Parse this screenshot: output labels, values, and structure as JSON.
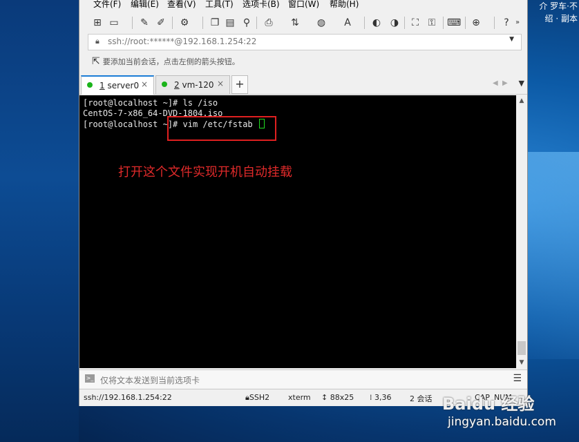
{
  "menu": [
    "文件(F)",
    "编辑(E)",
    "查看(V)",
    "工具(T)",
    "选项卡(B)",
    "窗口(W)",
    "帮助(H)"
  ],
  "desktop_right_text": [
    "介  罗车·不",
    "绍 · 副本"
  ],
  "address": {
    "lock_icon": "lock-icon",
    "text": "ssh://root:******@192.168.1.254:22"
  },
  "hint": "要添加当前会话，点击左侧的箭头按钮。",
  "tabs": [
    {
      "num": "1",
      "label": "server0",
      "active": true
    },
    {
      "num": "2",
      "label": "vm-120",
      "active": false
    }
  ],
  "terminal": {
    "lines": [
      "[root@localhost ~]# ls /iso",
      "CentOS-7-x86_64-DVD-1804.iso",
      "[root@localhost ~]# vim /etc/fstab "
    ],
    "annotation": "打开这个文件实现开机自动挂载"
  },
  "sendbar": {
    "placeholder": "仅将文本发送到当前选项卡"
  },
  "status": {
    "connection": "ssh://192.168.1.254:22",
    "protocol": "SSH2",
    "term": "xterm",
    "size": "88x25",
    "cursor": "3,36",
    "sessions": "2 会话",
    "caps": "CAP",
    "num": "NUM"
  },
  "watermark": {
    "brand": "Baidu 经验",
    "url": "jingyan.baidu.com"
  },
  "colors": {
    "accent": "#1a7cd6",
    "annotation": "#e02a2a",
    "cursor": "#22dd22"
  }
}
